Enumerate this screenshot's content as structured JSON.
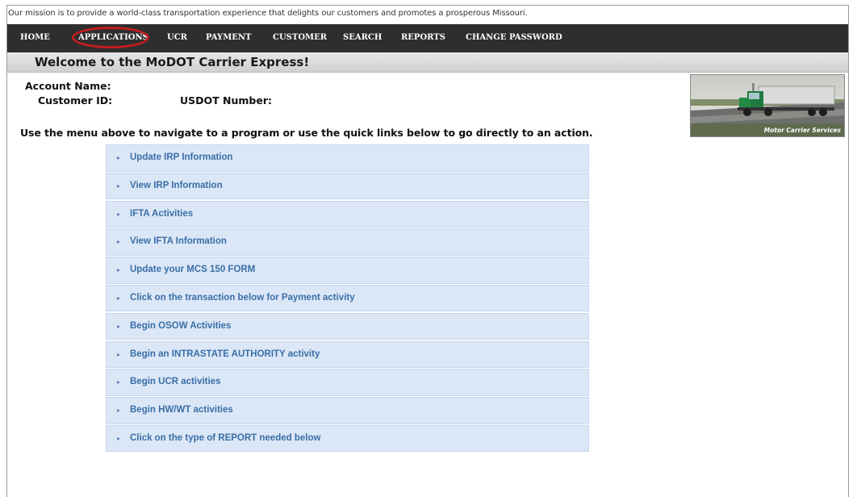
{
  "mission": "Our mission is to provide a world-class transportation experience that delights our customers and promotes a prosperous Missouri.",
  "nav": {
    "items": [
      "HOME",
      "APPLICATIONS",
      "UCR",
      "PAYMENT",
      "CUSTOMER",
      "SEARCH",
      "REPORTS",
      "CHANGE PASSWORD"
    ],
    "highlighted": "APPLICATIONS"
  },
  "welcome": "Welcome to the MoDOT Carrier Express!",
  "account": {
    "name_label": "Account Name:",
    "customer_id_label": "Customer ID:",
    "usdot_label": "USDOT Number:"
  },
  "intro": "Use the menu above to navigate to a program or use the quick links below to go directly to an action.",
  "photo_caption": "Motor Carrier Services",
  "quick_links": [
    "Update IRP Information",
    "View IRP Information",
    "IFTA Activities",
    "View IFTA Information",
    "Update your MCS 150 FORM",
    "Click on the transaction below for Payment activity",
    "Begin OSOW Activities",
    "Begin an INTRASTATE AUTHORITY activity",
    "Begin UCR activities",
    "Begin HW/WT activities",
    "Click on the type of REPORT needed below"
  ],
  "colors": {
    "nav_bg": "#2e2e2e",
    "highlight_circle": "#c61c1c",
    "link_bg": "#dbe7f7",
    "link_text": "#3a6ea6"
  }
}
